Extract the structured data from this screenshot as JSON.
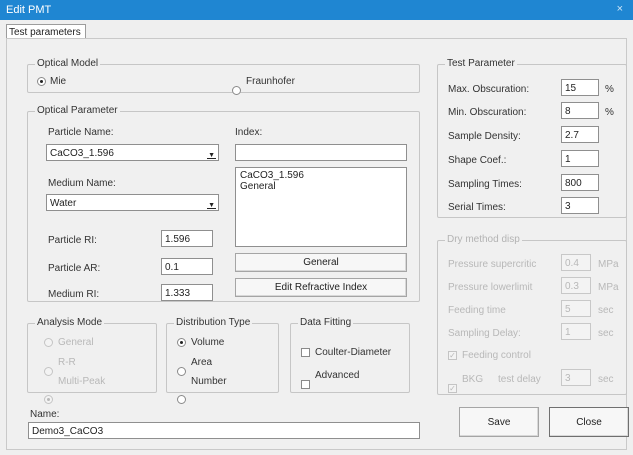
{
  "window": {
    "title": "Edit PMT",
    "close_glyph": "×"
  },
  "tabs": [
    {
      "label": "Test parameters"
    }
  ],
  "optical_model": {
    "legend": "Optical Model",
    "options": [
      {
        "label": "Mie",
        "checked": true
      },
      {
        "label": "Fraunhofer",
        "checked": false
      }
    ]
  },
  "optical_parameter": {
    "legend": "Optical Parameter",
    "particle_name_label": "Particle Name:",
    "particle_name_value": "CaCO3_1.596",
    "index_label": "Index:",
    "index_value": "",
    "medium_name_label": "Medium Name:",
    "medium_name_value": "Water",
    "index_list": [
      "CaCO3_1.596",
      "General"
    ],
    "particle_ri_label": "Particle RI:",
    "particle_ri_value": "1.596",
    "particle_ar_label": "Particle AR:",
    "particle_ar_value": "0.1",
    "medium_ri_label": "Medium RI:",
    "medium_ri_value": "1.333",
    "general_button": "General",
    "edit_refractive_button": "Edit Refractive Index"
  },
  "analysis_mode": {
    "legend": "Analysis Mode",
    "options": [
      {
        "label": "General",
        "checked": false
      },
      {
        "label": "R-R",
        "checked": false
      },
      {
        "label": "Multi-Peak",
        "checked": true
      }
    ]
  },
  "distribution_type": {
    "legend": "Distribution Type",
    "options": [
      {
        "label": "Volume",
        "checked": true
      },
      {
        "label": "Area",
        "checked": false
      },
      {
        "label": "Number",
        "checked": false
      }
    ]
  },
  "data_fitting": {
    "legend": "Data Fitting",
    "options": [
      {
        "label": "Coulter-Diameter",
        "checked": false
      },
      {
        "label": "Advanced",
        "checked": false
      }
    ]
  },
  "name_field": {
    "label": "Name:",
    "value": "Demo3_CaCO3"
  },
  "test_parameter": {
    "legend": "Test Parameter",
    "rows": [
      {
        "label": "Max. Obscuration:",
        "value": "15",
        "unit": "%"
      },
      {
        "label": "Min. Obscuration:",
        "value": "8",
        "unit": "%"
      },
      {
        "label": "Sample Density:",
        "value": "2.7",
        "unit": ""
      },
      {
        "label": "Shape Coef.:",
        "value": "1",
        "unit": ""
      },
      {
        "label": "Sampling Times:",
        "value": "800",
        "unit": ""
      },
      {
        "label": "Serial Times:",
        "value": "3",
        "unit": ""
      }
    ]
  },
  "dry_method": {
    "legend": "Dry method disp",
    "rows": [
      {
        "label": "Pressure supercritic",
        "value": "0.4",
        "unit": "MPa"
      },
      {
        "label": "Pressure lowerlimit",
        "value": "0.3",
        "unit": "MPa"
      },
      {
        "label": "Feeding time",
        "value": "5",
        "unit": "sec"
      },
      {
        "label": "Sampling Delay:",
        "value": "1",
        "unit": "sec"
      }
    ],
    "feeding_control_label": "Feeding control",
    "bkg_label": "BKG",
    "test_delay_label": "test delay",
    "bkg_value": "3",
    "bkg_unit": "sec"
  },
  "buttons": {
    "save": "Save",
    "close": "Close"
  }
}
